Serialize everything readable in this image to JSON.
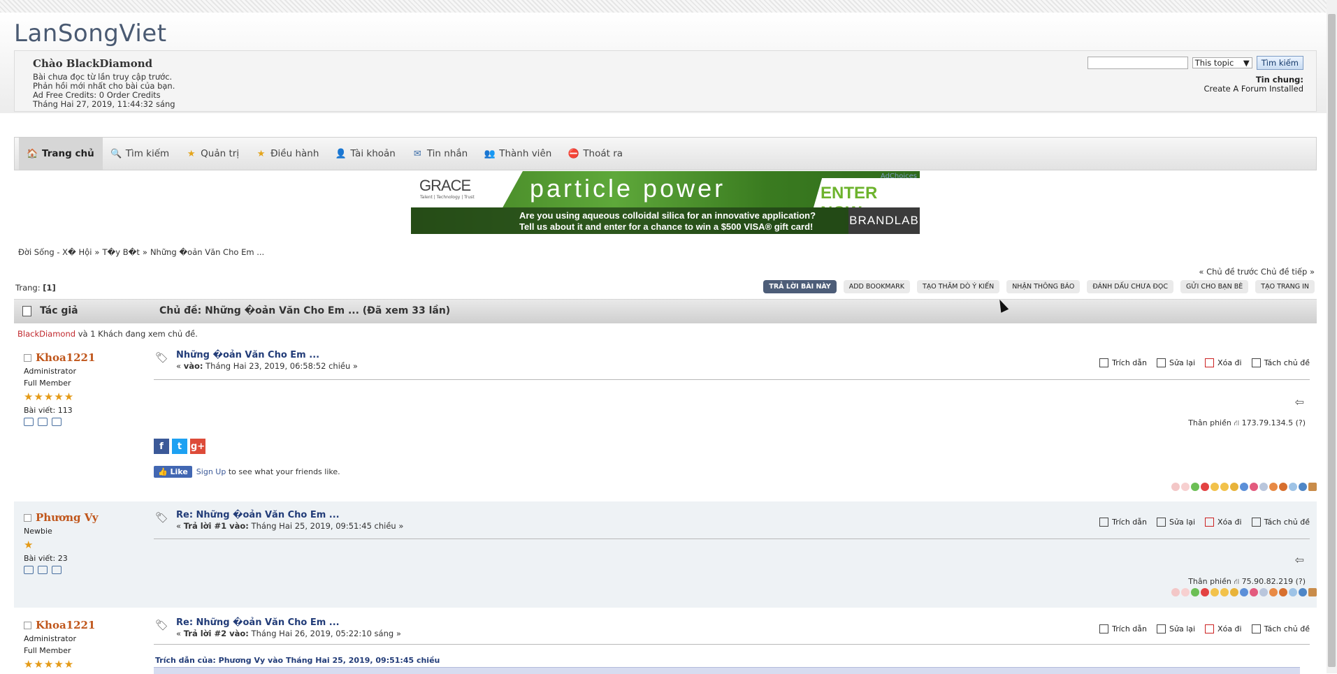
{
  "site": {
    "logo": "LanSongViet"
  },
  "user": {
    "greeting": "Chào BlackDiamond",
    "lines": [
      "Bài chưa đọc từ lần truy cập trước.",
      "Phản hồi mới nhất cho bài của bạn.",
      "Ad Free Credits: 0 Order Credits",
      "Tháng Hai 27, 2019, 11:44:32 sáng"
    ]
  },
  "search": {
    "scope": "This topic",
    "button": "Tìm kiếm",
    "placeholder": ""
  },
  "news": {
    "heading": "Tin chung:",
    "text": "Create A Forum Installed"
  },
  "nav": [
    {
      "label": "Trang chủ",
      "icon": "home-icon"
    },
    {
      "label": "Tìm kiếm",
      "icon": "search-icon"
    },
    {
      "label": "Quản trị",
      "icon": "star-icon"
    },
    {
      "label": "Điều hành",
      "icon": "star-icon"
    },
    {
      "label": "Tài khoản",
      "icon": "user-icon"
    },
    {
      "label": "Tin nhắn",
      "icon": "mail-icon"
    },
    {
      "label": "Thành viên",
      "icon": "members-icon"
    },
    {
      "label": "Thoát ra",
      "icon": "logout-icon"
    }
  ],
  "ad": {
    "brand": "GRACE",
    "tagline": "Talent | Technology | Trust",
    "headline": "particle power",
    "cta": "ENTER NOW",
    "choices": "AdChoices",
    "line1": "Are you using aqueous colloidal silica for an innovative application?",
    "line2": "Tell us about it and enter for a chance to win a $500 VISA® gift card!",
    "sponsor": "BRANDLAB"
  },
  "breadcrumb": [
    "Đời Sống - Xã Hội",
    "Tụy Bút",
    "Những Đoản Văn Cho Em ..."
  ],
  "breadcrumb_display": [
    "Đời Sống - X� Hội",
    "T�y B�t",
    "Những �oản Văn Cho Em ..."
  ],
  "prevnext": "« Chủ đề trước Chủ đề tiếp »",
  "pages": {
    "label": "Trang:",
    "current": "[1]"
  },
  "buttons": [
    "TRẢ LỜI BÀI NÀY",
    "ADD BOOKMARK",
    "TẠO THĂM DÒ Ý KIẾN",
    "NHẬN THÔNG BÁO",
    "ĐÁNH DẤU CHƯA ĐỌC",
    "GỬI CHO BẠN BÈ",
    "TẠO TRANG IN"
  ],
  "topic": {
    "author_col": "Tác giả",
    "subject": "Chủ đề: Những �oản Văn Cho Em ...  (Đã xem 33 lần)"
  },
  "viewing": {
    "user": "BlackDiamond",
    "rest": " và 1 Khách đang xem chủ đề."
  },
  "post_actions": [
    "Trích dẫn",
    "Sửa lại",
    "Xóa đi",
    "Tách chủ đề"
  ],
  "ip_prefix": "Thân phiền",
  "posts": [
    {
      "name": "Khoa1221",
      "rank": "Administrator",
      "group": "Full Member",
      "stars": "★★★★★",
      "count": "Bài viết: 113",
      "title": "Những �oản Văn Cho Em ...",
      "meta_pre": "« ",
      "meta_b": "vào:",
      "meta": " Tháng Hai 23, 2019, 06:58:52 chiều »",
      "ip": "173.79.134.5 (?)"
    },
    {
      "name": "Phương Vy",
      "rank": "Newbie",
      "stars": "★",
      "count": "Bài viết: 23",
      "title": "Re: Những �oản Văn Cho Em ...",
      "meta_pre": "« ",
      "meta_b": "Trả lời #1 vào:",
      "meta": " Tháng Hai 25, 2019, 09:51:45 chiều »",
      "ip": "75.90.82.219 (?)"
    },
    {
      "name": "Khoa1221",
      "rank": "Administrator",
      "group": "Full Member",
      "stars": "★★★★★",
      "title": "Re: Những �oản Văn Cho Em ...",
      "meta_pre": "« ",
      "meta_b": "Trả lời #2 vào:",
      "meta": " Tháng Hai 26, 2019, 05:22:10 sáng »",
      "quote": "Trích dẫn của: Phương Vy vào Tháng Hai 25, 2019, 09:51:45 chiều"
    }
  ],
  "social": {
    "like": "Like",
    "signup": "Sign Up",
    "like_text": " to see what your friends like."
  }
}
